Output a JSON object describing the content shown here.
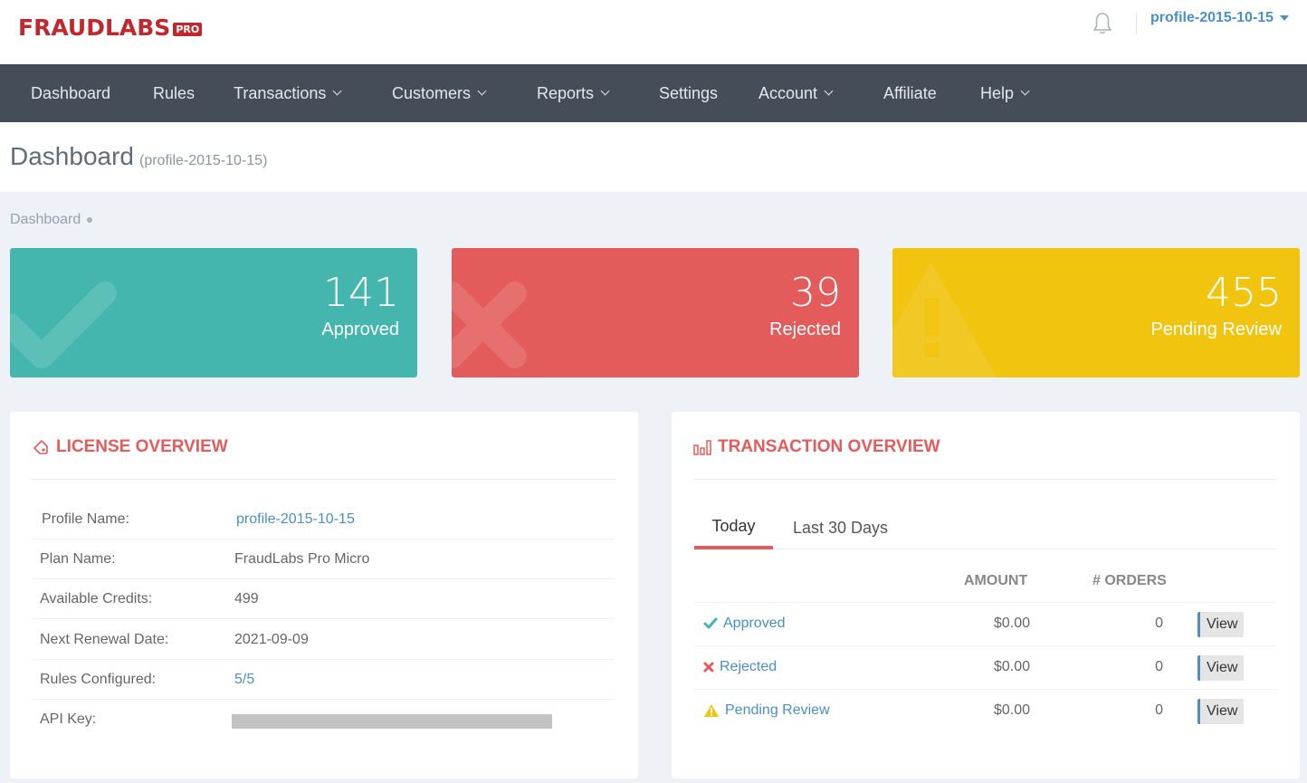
{
  "header": {
    "logo_text": "FRAUDLABS",
    "logo_badge": "PRO",
    "profile_label": "profile-2015-10-15"
  },
  "nav": {
    "items": [
      {
        "label": "Dashboard"
      },
      {
        "label": "Rules"
      },
      {
        "label": "Transactions"
      },
      {
        "label": "Customers"
      },
      {
        "label": "Reports"
      },
      {
        "label": "Settings"
      },
      {
        "label": "Account"
      },
      {
        "label": "Affiliate"
      },
      {
        "label": "Help"
      }
    ]
  },
  "page": {
    "title": "Dashboard",
    "subtitle": "(profile-2015-10-15)",
    "breadcrumb": "Dashboard"
  },
  "stats": {
    "approved": {
      "value": "141",
      "label": "Approved",
      "color": "#44b6ae"
    },
    "rejected": {
      "value": "39",
      "label": "Rejected",
      "color": "#e35b5a"
    },
    "pending": {
      "value": "455",
      "label": "Pending Review",
      "color": "#f1c40f"
    }
  },
  "license": {
    "title": "LICENSE OVERVIEW",
    "rows": [
      {
        "label": "Profile Name:",
        "value": "profile-2015-10-15"
      },
      {
        "label": "Plan Name:",
        "value": "FraudLabs Pro Micro"
      },
      {
        "label": "Available Credits:",
        "value": "499"
      },
      {
        "label": "Next Renewal Date:",
        "value": "2021-09-09"
      },
      {
        "label": "Rules Configured:",
        "value": "5/5"
      },
      {
        "label": "API Key:",
        "value": ""
      }
    ]
  },
  "transactions": {
    "title": "TRANSACTION OVERVIEW",
    "tabs": [
      {
        "label": "Today"
      },
      {
        "label": "Last 30 Days"
      }
    ],
    "columns": {
      "amount": "AMOUNT",
      "orders": "# ORDERS"
    },
    "rows": [
      {
        "status": "Approved",
        "amount": "$0.00",
        "orders": "0",
        "action": "View"
      },
      {
        "status": "Rejected",
        "amount": "$0.00",
        "orders": "0",
        "action": "View"
      },
      {
        "status": "Pending Review",
        "amount": "$0.00",
        "orders": "0",
        "action": "View"
      }
    ]
  },
  "icons": {
    "bell": "bell-icon",
    "license": "tag-icon",
    "transaction": "bar-chart-icon",
    "approved": "check-icon",
    "rejected": "x-icon",
    "pending": "warning-icon"
  }
}
